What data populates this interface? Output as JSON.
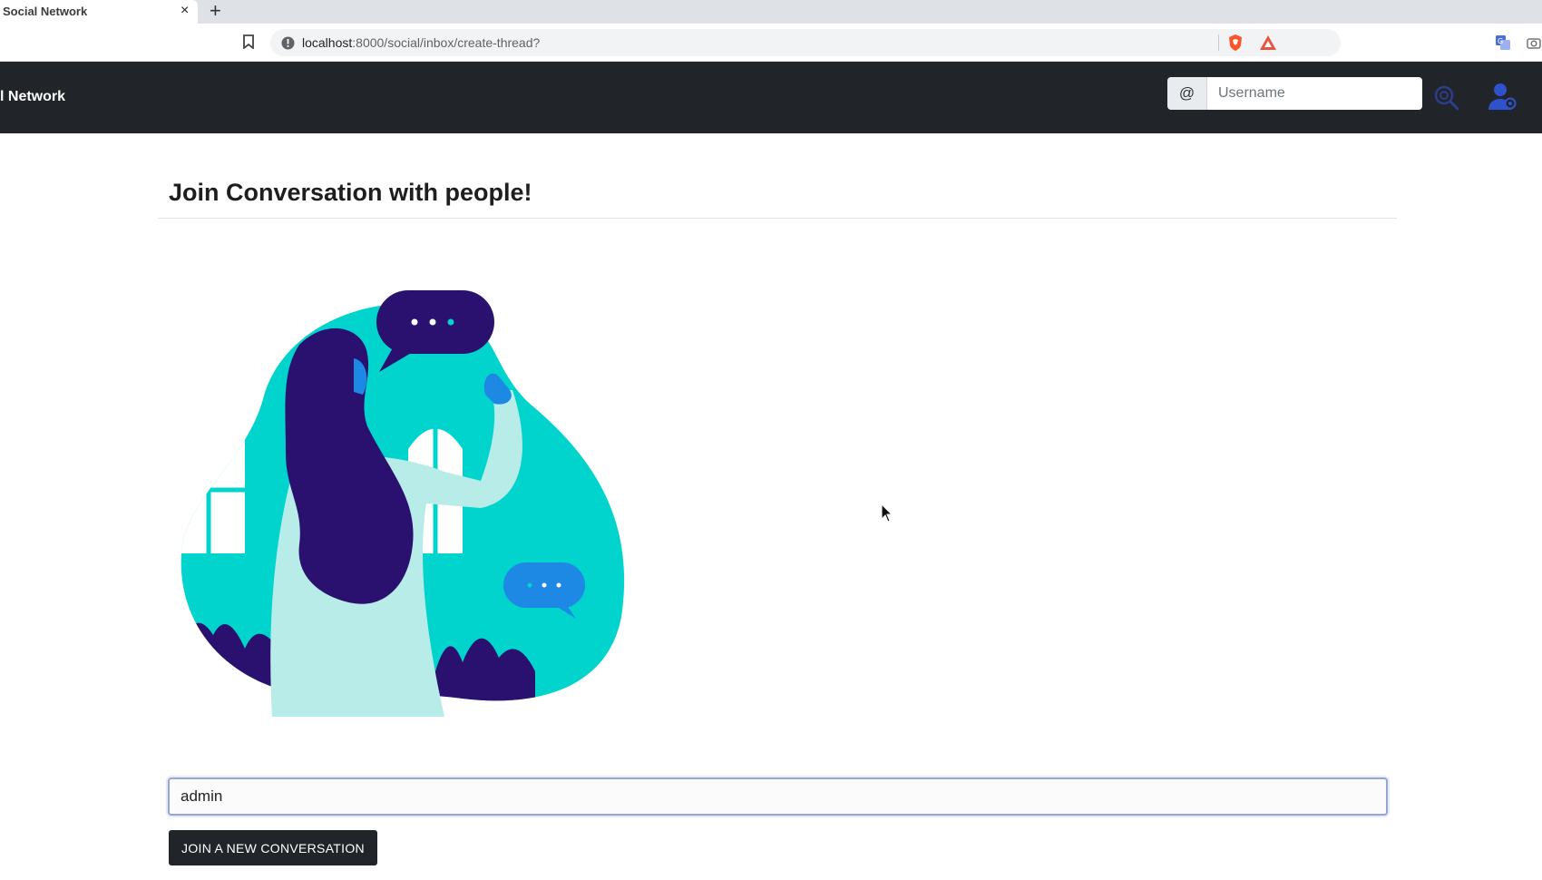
{
  "browser": {
    "tab_title": "Social Network",
    "tab_close": "×",
    "new_tab": "+",
    "url_host": "localhost",
    "url_path": ":8000/social/inbox/create-thread?"
  },
  "navbar": {
    "brand": "l Network",
    "at_symbol": "@",
    "search_placeholder": "Username"
  },
  "main": {
    "title": "Join Conversation with people!",
    "username_value": "admin",
    "join_button_label": "JOIN A NEW CONVERSATION"
  },
  "colors": {
    "navbar_bg": "#212529",
    "illustration_teal": "#00d4cc",
    "illustration_purple": "#2a1170",
    "illustration_blue": "#1e88e5"
  }
}
